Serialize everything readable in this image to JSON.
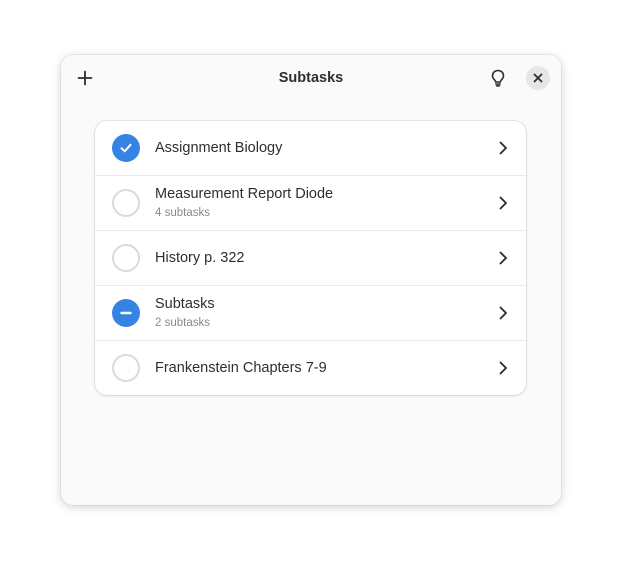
{
  "window": {
    "title": "Subtasks"
  },
  "colors": {
    "accent": "#3584e4",
    "window_bg": "#fafafa",
    "card_bg": "#ffffff"
  },
  "header": {
    "add_icon": "plus-icon",
    "hint_icon": "lightbulb-icon",
    "close_icon": "close-icon"
  },
  "tasks": [
    {
      "label": "Assignment Biology",
      "subtitle": "",
      "state": "checked"
    },
    {
      "label": "Measurement Report Diode",
      "subtitle": "4 subtasks",
      "state": "unchecked"
    },
    {
      "label": "History p. 322",
      "subtitle": "",
      "state": "unchecked"
    },
    {
      "label": "Subtasks",
      "subtitle": "2 subtasks",
      "state": "partial"
    },
    {
      "label": "Frankenstein Chapters 7-9",
      "subtitle": "",
      "state": "unchecked"
    }
  ]
}
